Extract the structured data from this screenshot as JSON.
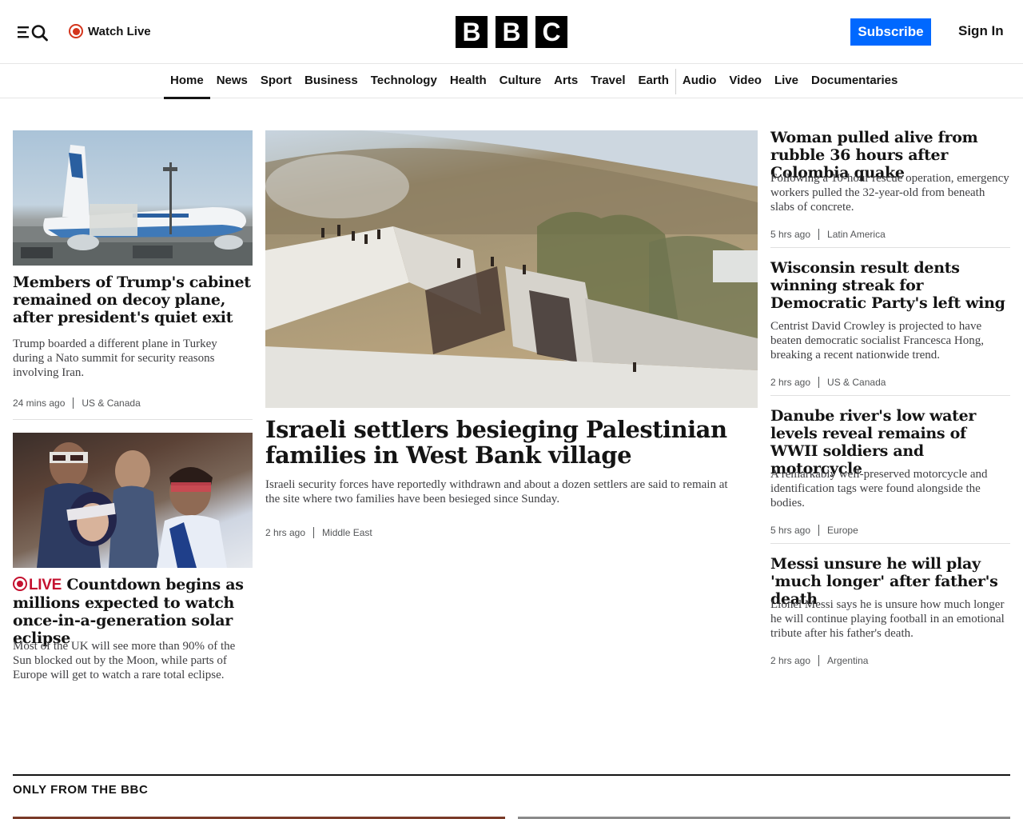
{
  "header": {
    "watch_live_label": "Watch Live",
    "logo_letters": [
      "B",
      "B",
      "C"
    ],
    "subscribe_label": "Subscribe",
    "signin_label": "Sign In",
    "accent_color": "#0068ff",
    "live_color": "#d4351c"
  },
  "nav": {
    "items": [
      "Home",
      "News",
      "Sport",
      "Business",
      "Technology",
      "Health",
      "Culture",
      "Arts",
      "Travel",
      "Earth",
      "Audio",
      "Video",
      "Live",
      "Documentaries"
    ],
    "active": "Home"
  },
  "left_column": {
    "story1": {
      "headline": "Members of Trump's cabinet remained on decoy plane, after president's quiet exit",
      "summary": "Trump boarded a different plane in Turkey during a Nato summit for security reasons involving Iran.",
      "time": "24 mins ago",
      "category": "US & Canada",
      "image_icon": "plane-image"
    },
    "story2": {
      "live_label": "LIVE",
      "headline": "Countdown begins as millions expected to watch once-in-a-generation solar eclipse",
      "summary": "Most of the UK will see more than 90% of the Sun blocked out by the Moon, while parts of Europe will get to watch a rare total eclipse.",
      "image_icon": "eclipse-viewers-image"
    }
  },
  "main_story": {
    "headline": "Israeli settlers besieging Palestinian families in West Bank village",
    "summary": "Israeli security forces have reportedly withdrawn and about a dozen settlers are said to remain at the site where two families have been besieged since Sunday.",
    "time": "2 hrs ago",
    "category": "Middle East",
    "image_icon": "west-bank-village-image"
  },
  "right_column": [
    {
      "headline": "Woman pulled alive from rubble 36 hours after Colombia quake",
      "summary": "Following a 10-hour rescue operation, emergency workers pulled the 32-year-old from beneath slabs of concrete.",
      "time": "5 hrs ago",
      "category": "Latin America"
    },
    {
      "headline": "Wisconsin result dents winning streak for Democratic Party's left wing",
      "summary": "Centrist David Crowley is projected to have beaten democratic socialist Francesca Hong, breaking a recent nationwide trend.",
      "time": "2 hrs ago",
      "category": "US & Canada"
    },
    {
      "headline": "Danube river's low water levels reveal remains of WWII soldiers and motorcycle",
      "summary": "A remarkably well-preserved motorcycle and identification tags were found alongside the bodies.",
      "time": "5 hrs ago",
      "category": "Europe"
    },
    {
      "headline": "Messi unsure he will play 'much longer' after father's death",
      "summary": "Lionel Messi says he is unsure how much longer he will continue playing football in an emotional tribute after his father's death.",
      "time": "2 hrs ago",
      "category": "Argentina"
    }
  ],
  "section": {
    "title": "ONLY FROM THE BBC"
  }
}
